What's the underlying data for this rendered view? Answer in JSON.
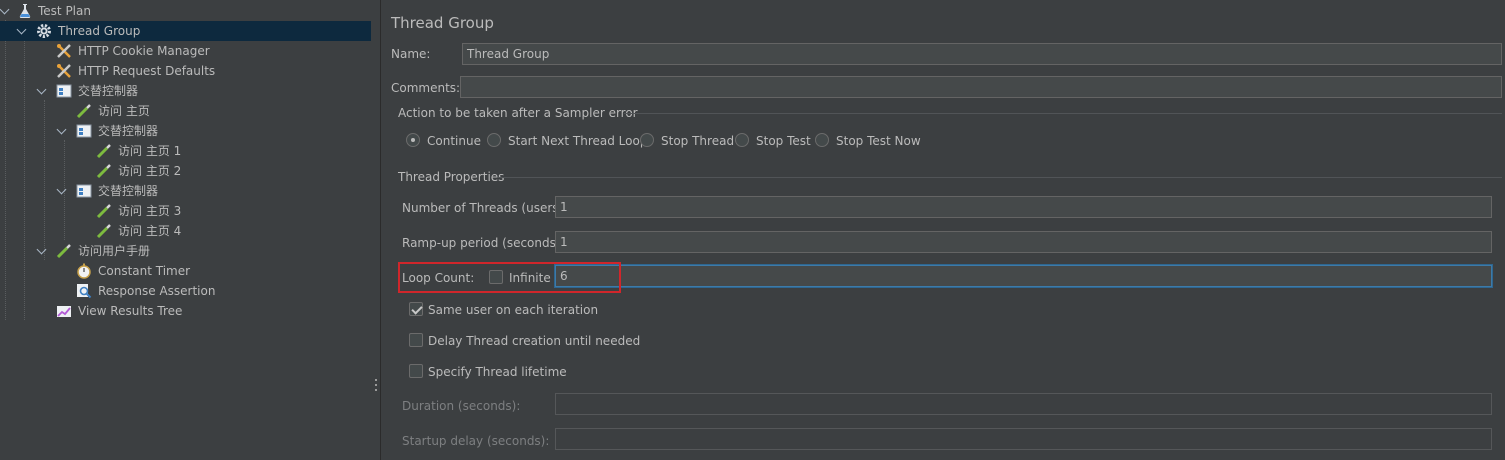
{
  "tree": {
    "items": [
      {
        "label": "Test Plan",
        "icon": "flask-icon"
      },
      {
        "label": "Thread Group",
        "icon": "gear-icon"
      },
      {
        "label": "HTTP Cookie Manager",
        "icon": "tools-icon"
      },
      {
        "label": "HTTP Request Defaults",
        "icon": "tools-icon"
      },
      {
        "label": "交替控制器",
        "icon": "controller-icon"
      },
      {
        "label": "访问 主页",
        "icon": "pipette-icon"
      },
      {
        "label": "交替控制器",
        "icon": "controller-icon"
      },
      {
        "label": "访问 主页 1",
        "icon": "pipette-icon"
      },
      {
        "label": "访问 主页 2",
        "icon": "pipette-icon"
      },
      {
        "label": "交替控制器",
        "icon": "controller-icon"
      },
      {
        "label": "访问 主页 3",
        "icon": "pipette-icon"
      },
      {
        "label": "访问 主页 4",
        "icon": "pipette-icon"
      },
      {
        "label": "访问用户手册",
        "icon": "pipette-icon"
      },
      {
        "label": "Constant Timer",
        "icon": "stopwatch-icon"
      },
      {
        "label": "Response Assertion",
        "icon": "magnifier-icon"
      },
      {
        "label": "View Results Tree",
        "icon": "chart-icon"
      }
    ],
    "selected_index": 1
  },
  "panel": {
    "title": "Thread Group",
    "name_label": "Name:",
    "name_value": "Thread Group",
    "comments_label": "Comments:",
    "comments_value": "",
    "sampler_error_section": "Action to be taken after a Sampler error",
    "sampler_error_options": [
      "Continue",
      "Start Next Thread Loop",
      "Stop Thread",
      "Stop Test",
      "Stop Test Now"
    ],
    "sampler_error_selected": "Continue",
    "thread_props_section": "Thread Properties",
    "threads_label": "Number of Threads (users):",
    "threads_value": "1",
    "rampup_label": "Ramp-up period (seconds):",
    "rampup_value": "1",
    "loop_label": "Loop Count:",
    "infinite_label": "Infinite",
    "infinite_checked": false,
    "loop_value": "6",
    "same_user_label": "Same user on each iteration",
    "same_user_checked": true,
    "delay_label": "Delay Thread creation until needed",
    "delay_checked": false,
    "lifetime_label": "Specify Thread lifetime",
    "lifetime_checked": false,
    "duration_label": "Duration (seconds):",
    "duration_value": "",
    "startup_label": "Startup delay (seconds):",
    "startup_value": ""
  },
  "colors": {
    "background": "#3c3f41",
    "selection": "#0d293e",
    "highlight": "#d0262b",
    "focus": "#3d7aa8"
  }
}
